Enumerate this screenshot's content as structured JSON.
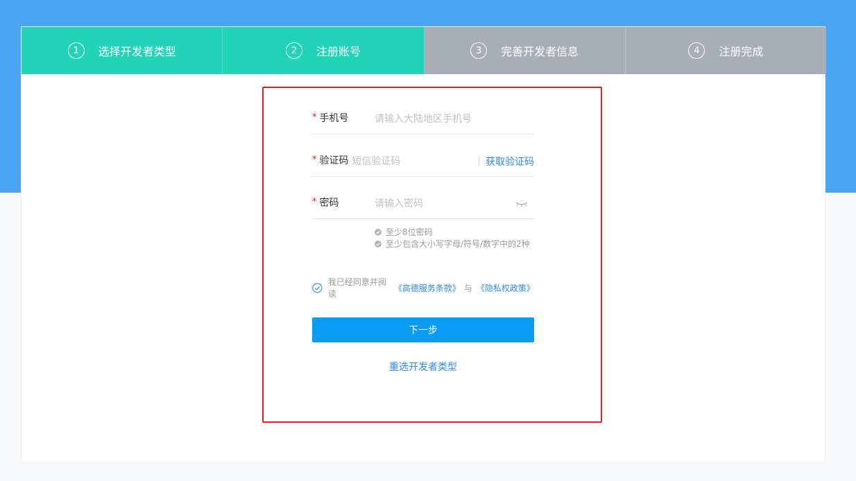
{
  "steps": [
    {
      "num": "1",
      "label": "选择开发者类型",
      "state": "done"
    },
    {
      "num": "2",
      "label": "注册账号",
      "state": "current"
    },
    {
      "num": "3",
      "label": "完善开发者信息",
      "state": "todo"
    },
    {
      "num": "4",
      "label": "注册完成",
      "state": "todo"
    }
  ],
  "form": {
    "phone": {
      "label": "手机号",
      "required_mark": "*",
      "placeholder": "请输入大陆地区手机号",
      "value": ""
    },
    "code": {
      "label": "验证码",
      "required_mark": "*",
      "placeholder": "短信验证码",
      "value": "",
      "get_code_label": "获取验证码"
    },
    "password": {
      "label": "密码",
      "required_mark": "*",
      "placeholder": "请输入密码",
      "value": "",
      "toggle_icon": "eye-closed-icon"
    },
    "hints": [
      "至少8位密码",
      "至少包含大小写字母/符号/数字中的2种"
    ],
    "agreement": {
      "prefix": "我已经同意并阅读",
      "terms_link": "《高德服务条款》",
      "connector": "与",
      "privacy_link": "《隐私权政策》",
      "checked": true
    },
    "next_button": "下一步",
    "reselect_link": "重选开发者类型"
  },
  "colors": {
    "header_blue": "#4aa6f2",
    "step_done": "#21d4b7",
    "step_todo": "#a9adb6",
    "primary_button": "#0a9cf5",
    "link": "#2e8ae6",
    "required": "#e02020",
    "highlight_border": "#e02020"
  }
}
